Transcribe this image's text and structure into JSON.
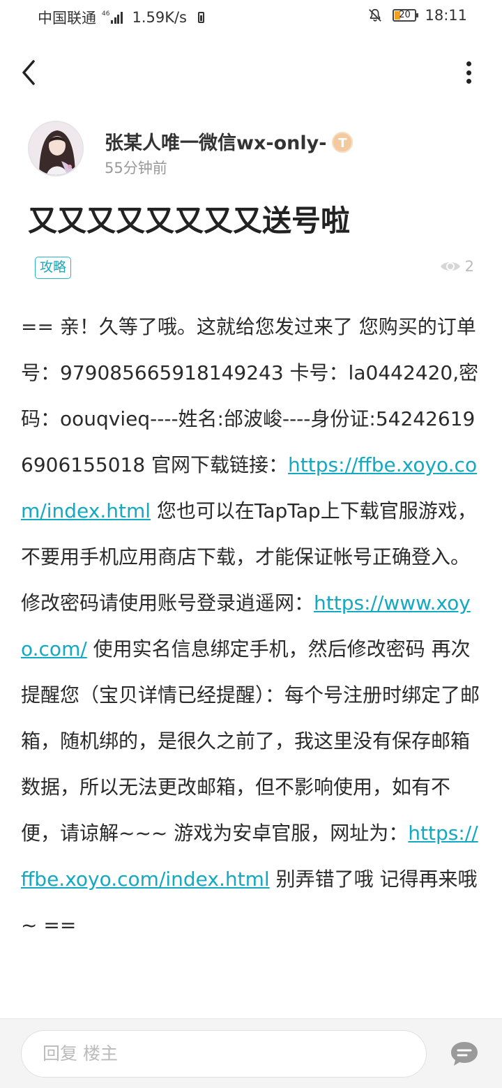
{
  "status_bar": {
    "carrier": "中国联通",
    "network_tag": "46",
    "speed": "1.59K/s",
    "battery_level": "20",
    "time": "18:11",
    "icons": [
      "signal-icon",
      "battery-saver-icon",
      "mute-bell-icon",
      "battery-icon"
    ]
  },
  "app_bar": {
    "icons": [
      "back-arrow-icon",
      "more-vertical-icon"
    ]
  },
  "author": {
    "name": "张某人唯一微信wx-only-",
    "badge": "T",
    "time": "55分钟前"
  },
  "post": {
    "title": "又又又又又又又又送号啦",
    "tag": "攻略",
    "views": "2",
    "body": {
      "p1": "== 亲！久等了哦。这就给您发过来了 您购买的订单号：97908566591814924​3 卡号：la0442420,密码：oouqvieq----姓名:邰波峻----身份证:542426196906155018 官网下载链接：",
      "link1": "https://ffbe.xoyo.com/index.html",
      "p2": " 您也可以在TapTap上下载官服游戏，不要用手机应用商店下载，才能保证帐号正确登入。修改密码请使用账号登录逍遥网：",
      "link2": "https://www.xoyo.com/",
      "p3": " 使用实名信息绑定手机，然后修改密码 再次提醒您（宝贝详情已经提醒）：每个号注册时绑定了邮箱，随机绑的，是很久之前了，我这里没有保存邮箱数据，所以无法更改邮箱，但不影响使用，如有不便，请谅解~~~ 游戏为安卓官服，网址为：",
      "link3": "https://ffbe.xoyo.com/index.html",
      "p4": " 别弄错了哦 记得再来哦~ =="
    }
  },
  "reply_bar": {
    "placeholder": "回复  楼主"
  },
  "colors": {
    "accent": "#14a9c2",
    "text": "#2a2a2a",
    "muted": "#999999"
  }
}
